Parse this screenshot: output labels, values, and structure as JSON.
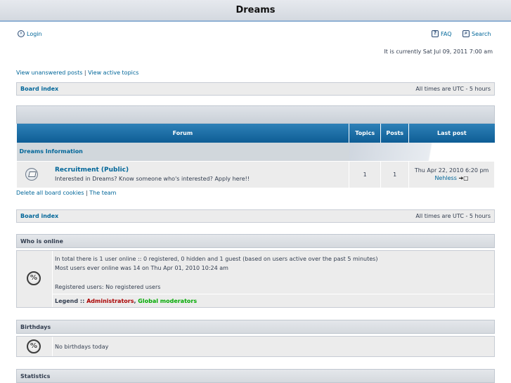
{
  "site": {
    "title": "Dreams"
  },
  "nav": {
    "login_label": "Login",
    "faq_label": "FAQ",
    "search_label": "Search",
    "current_time": "It is currently Sat Jul 09, 2011 7:00 am",
    "view_unanswered": "View unanswered posts",
    "separator": " | ",
    "view_active": "View active topics"
  },
  "breadcrumb": {
    "board_index": "Board index",
    "timezone": "All times are UTC - 5 hours"
  },
  "forum_table": {
    "headers": {
      "forum": "Forum",
      "topics": "Topics",
      "posts": "Posts",
      "last_post": "Last post"
    },
    "category": "Dreams Information",
    "forums": [
      {
        "name": "Recruitment (Public)",
        "description": "Interested in Dreams? Know someone who's interested? Apply here!!",
        "topics": "1",
        "posts": "1",
        "last_post_date": "Thu Apr 22, 2010 6:20 pm",
        "last_post_author": "Nehless"
      }
    ]
  },
  "footer_links": {
    "delete_cookies": "Delete all board cookies",
    "separator": " | ",
    "team": "The team"
  },
  "who_is_online": {
    "title": "Who is online",
    "line1": "In total there is 1 user online :: 0 registered, 0 hidden and 1 guest (based on users active over the past 5 minutes)",
    "line2": "Most users ever online was 14 on Thu Apr 01, 2010 10:24 am",
    "registered": "Registered users: No registered users",
    "legend_label": "Legend :: ",
    "legend_admin": "Administrators",
    "legend_sep": ", ",
    "legend_gmod": "Global moderators"
  },
  "birthdays": {
    "title": "Birthdays",
    "text": "No birthdays today"
  },
  "statistics": {
    "title": "Statistics"
  }
}
